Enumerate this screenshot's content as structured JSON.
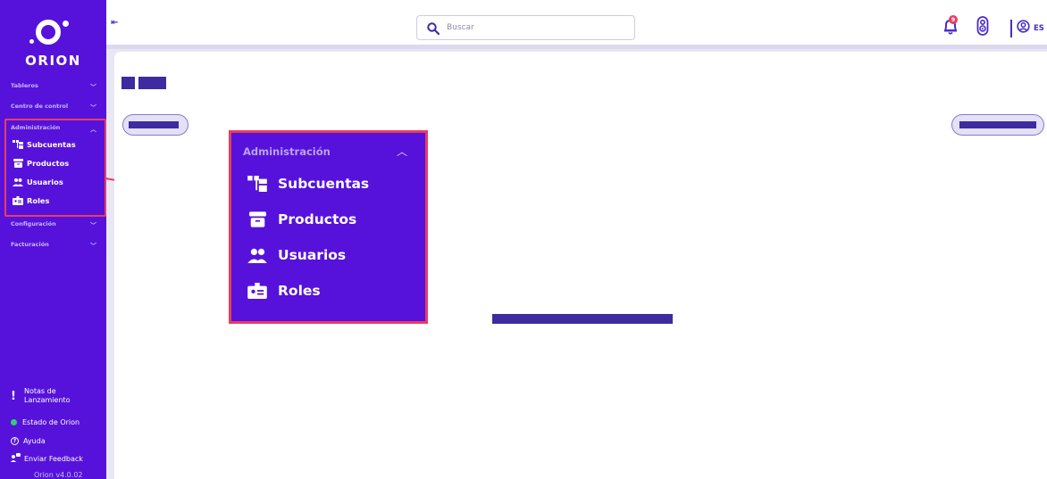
{
  "app": {
    "logo_text": "ORION",
    "language": "ES",
    "version": "Orion v4.0.02"
  },
  "search": {
    "placeholder": "Buscar"
  },
  "notification": {
    "badge": "9"
  },
  "sidebar": {
    "sections": [
      {
        "label": "Tableros"
      },
      {
        "label": "Centro de control"
      },
      {
        "label": "Administración"
      },
      {
        "label": "Configuración"
      },
      {
        "label": "Facturación"
      }
    ],
    "admin_items": [
      {
        "label": "Subcuentas",
        "icon": "subaccounts-icon"
      },
      {
        "label": "Productos",
        "icon": "archive-box-icon"
      },
      {
        "label": "Usuarios",
        "icon": "users-icon"
      },
      {
        "label": "Roles",
        "icon": "id-badge-icon"
      }
    ],
    "bottom": [
      {
        "label": "Notas de Lanzamiento",
        "icon": "exclamation-icon"
      },
      {
        "label": "Estado de Orion",
        "icon": "status-dot-icon"
      },
      {
        "label": "Ayuda",
        "icon": "help-icon"
      },
      {
        "label": "Enviar Feedback",
        "icon": "feedback-icon"
      }
    ]
  },
  "zoom": {
    "header": "Administración",
    "items": [
      {
        "label": "Subcuentas"
      },
      {
        "label": "Productos"
      },
      {
        "label": "Usuarios"
      },
      {
        "label": "Roles"
      }
    ]
  },
  "colors": {
    "sidebar": "#5612db",
    "highlight": "#e83c63",
    "accent": "#4a2ccb",
    "placeholder_block": "#3e2b9f",
    "status_green": "#2fd16a"
  }
}
